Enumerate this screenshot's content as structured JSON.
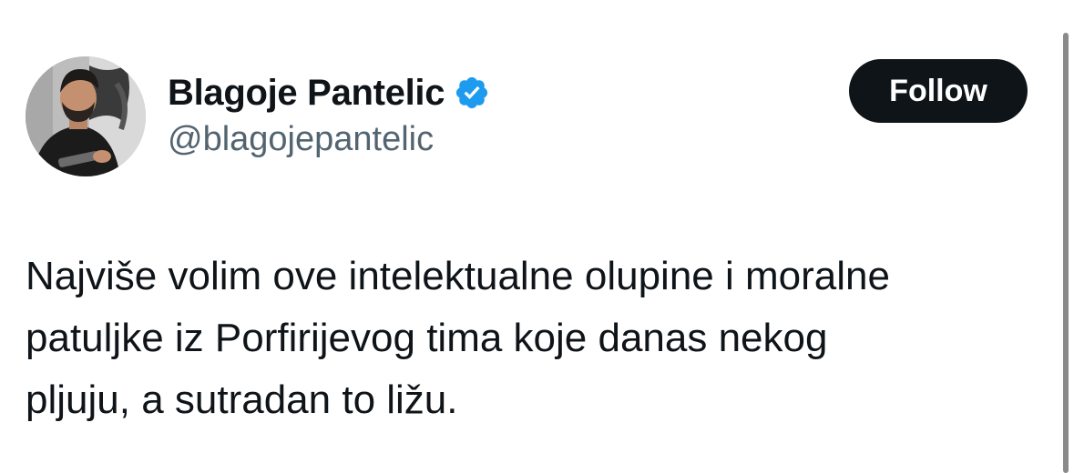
{
  "author": {
    "display_name": "Blagoje Pantelic",
    "handle": "@blagojepantelic",
    "verified": true,
    "avatar_icon": "profile-photo"
  },
  "actions": {
    "follow_label": "Follow"
  },
  "tweet": {
    "lines": [
      "Najviše volim ove intelektualne olupine i moralne",
      "patuljke iz Porfirijevog tima koje danas nekog",
      "pljuju, a sutradan to ližu."
    ]
  },
  "colors": {
    "text_primary": "#0f1419",
    "text_secondary": "#536471",
    "verified_badge": "#1d9bf0",
    "button_bg": "#0f1419",
    "button_text": "#ffffff"
  }
}
